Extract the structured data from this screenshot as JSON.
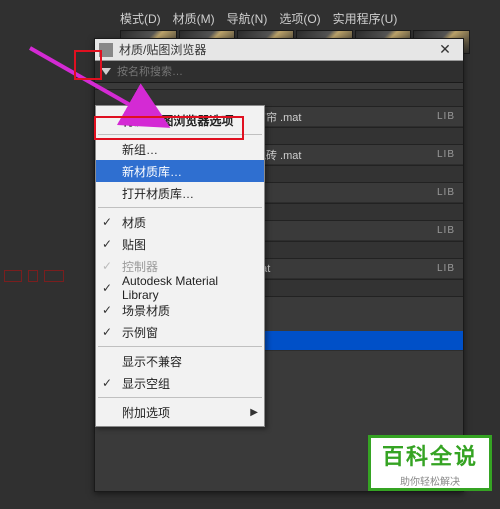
{
  "menubar": {
    "items": [
      "模式(D)",
      "材质(M)",
      "导航(N)",
      "选项(O)",
      "实用程序(U)"
    ]
  },
  "browser": {
    "title": "材质/贴图浏览器",
    "close": "✕",
    "search_placeholder": "按名称搜索…"
  },
  "materials": {
    "rows": [
      {
        "name": "窗帘 .mat",
        "tag": "LIB"
      },
      {
        "name": "地砖 .mat",
        "tag": "LIB"
      },
      {
        "name": "",
        "tag": "LIB"
      },
      {
        "name": "",
        "tag": "LIB"
      },
      {
        "name": "nat",
        "tag": "LIB"
      }
    ]
  },
  "context_menu": {
    "header": "材质/贴图浏览器选项",
    "new_group": "新组…",
    "new_library": "新材质库…",
    "open_library": "打开材质库…",
    "checks": {
      "material": "材质",
      "map": "贴图",
      "controller": "控制器",
      "aml": "Autodesk Material Library",
      "scene_mat": "场景材质",
      "sample": "示例窗"
    },
    "show_incompatible": "显示不兼容",
    "show_empty": "显示空组",
    "extra": "附加选项"
  },
  "badge": {
    "title": "百科全说",
    "subtitle": "助你轻松解决"
  }
}
